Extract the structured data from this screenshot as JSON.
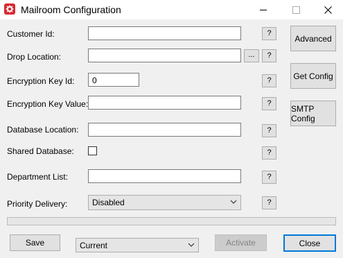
{
  "window": {
    "title": "Mailroom Configuration"
  },
  "colors": {
    "app_icon": "#d7282f",
    "focus_border": "#0078d7"
  },
  "icons": {
    "app": "gear-icon",
    "minimize": "minimize-icon",
    "maximize": "maximize-icon",
    "close": "close-icon",
    "dropdown": "chevron-down-icon"
  },
  "fields": {
    "customer_id": {
      "label": "Customer Id:",
      "value": ""
    },
    "drop_location": {
      "label": "Drop Location:",
      "value": "",
      "browse_label": "..."
    },
    "encryption_key_id": {
      "label": "Encryption Key Id:",
      "value": "0"
    },
    "encryption_key_value": {
      "label": "Encryption Key Value:",
      "value": ""
    },
    "database_location": {
      "label": "Database Location:",
      "value": ""
    },
    "shared_database": {
      "label": "Shared Database:",
      "checked": false
    },
    "department_list": {
      "label": "Department List:",
      "value": ""
    },
    "priority_delivery": {
      "label": "Priority Delivery:",
      "selected": "Disabled"
    }
  },
  "help_label": "?",
  "side_buttons": {
    "advanced": "Advanced",
    "get_config": "Get Config",
    "smtp_config": "SMTP Config"
  },
  "footer": {
    "save": "Save",
    "environment_selected": "Current",
    "activate": "Activate",
    "close": "Close"
  }
}
